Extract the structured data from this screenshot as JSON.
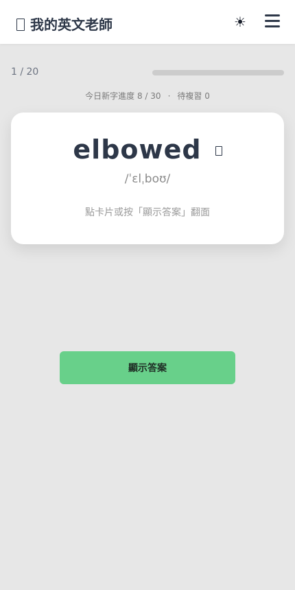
{
  "header": {
    "title": "我的英文老師",
    "theme_toggle_glyph": "☀",
    "icons": {
      "brand": "book-icon",
      "theme": "sun-icon",
      "menu": "hamburger-menu-icon"
    }
  },
  "session": {
    "counter": "1 / 20",
    "progress_fraction": 0.0
  },
  "stats": {
    "new_words": "今日新字進度 8 / 30",
    "separator": "·",
    "review": "待複習 0"
  },
  "card": {
    "word": "elbowed",
    "phonetic": "/ˈɛlˌboʊ/",
    "hint": "點卡片或按「顯示答案」翻面",
    "speaker_icon": "speaker-icon"
  },
  "actions": {
    "show_answer_label": "顯示答案"
  },
  "colors": {
    "background": "#e7e7e7",
    "accent_green": "#68d08a",
    "progress_track": "#cccccc",
    "text_primary": "#2d3748"
  }
}
